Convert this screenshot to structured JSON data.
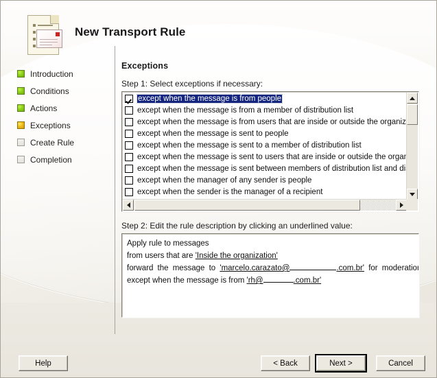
{
  "window": {
    "title": "New Transport Rule",
    "icon": "document-envelope-icon"
  },
  "sidebar": {
    "items": [
      {
        "label": "Introduction",
        "state": "done"
      },
      {
        "label": "Conditions",
        "state": "done"
      },
      {
        "label": "Actions",
        "state": "done"
      },
      {
        "label": "Exceptions",
        "state": "current"
      },
      {
        "label": "Create Rule",
        "state": "pending"
      },
      {
        "label": "Completion",
        "state": "pending"
      }
    ]
  },
  "content": {
    "heading": "Exceptions",
    "step1_label": "Step 1: Select exceptions if necessary:",
    "step2_label": "Step 2: Edit the rule description by clicking an underlined value:",
    "exceptions": [
      {
        "label": "except when the message is from people",
        "checked": true,
        "selected": true
      },
      {
        "label": "except when the message is from a member of distribution list",
        "checked": false,
        "selected": false
      },
      {
        "label": "except when the message is from users that are inside or outside the organization",
        "checked": false,
        "selected": false
      },
      {
        "label": "except when the message is sent to people",
        "checked": false,
        "selected": false
      },
      {
        "label": "except when the message is sent to a member of distribution list",
        "checked": false,
        "selected": false
      },
      {
        "label": "except when the message is sent to users that are inside or outside the organization",
        "checked": false,
        "selected": false
      },
      {
        "label": "except when the message is sent between members of distribution list and distribution list",
        "checked": false,
        "selected": false
      },
      {
        "label": "except when the manager of any sender is people",
        "checked": false,
        "selected": false
      },
      {
        "label": "except when the sender is the manager of a recipient",
        "checked": false,
        "selected": false
      }
    ],
    "description": {
      "line1": "Apply rule to messages",
      "line2_prefix": "from users that are ",
      "line2_value": "'Inside the organization'",
      "line3_prefix": "forward the message to ",
      "line3_value_start": "'marcelo.carazato@",
      "line3_value_end": ".com.br'",
      "line3_suffix": " for moderation",
      "line4_prefix": "except when the message is from ",
      "line4_value_start": "'rh@",
      "line4_value_end": ".com.br'"
    }
  },
  "scrollbars": {
    "vertical_up": "scroll-up-arrow",
    "vertical_down": "scroll-down-arrow",
    "horizontal_left": "scroll-left-arrow",
    "horizontal_right": "scroll-right-arrow"
  },
  "footer": {
    "help": "Help",
    "back": "< Back",
    "next": "Next >",
    "cancel": "Cancel"
  },
  "colors": {
    "selection": "#13257f",
    "step_done": "#8fd319",
    "step_current": "#f0bc18",
    "dialog_face": "#ece9e1"
  }
}
